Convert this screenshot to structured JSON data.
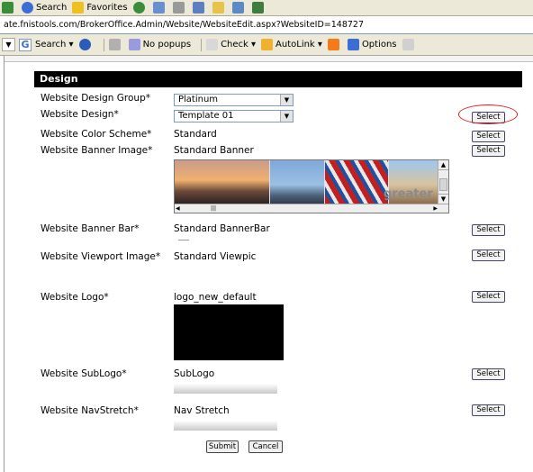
{
  "toolbar1": {
    "search_label": "Search",
    "favorites_label": "Favorites"
  },
  "address": {
    "url": "ate.fnistools.com/BrokerOffice.Admin/Website/WebsiteEdit.aspx?WebsiteID=148727"
  },
  "toolbar3": {
    "google_letter": "G",
    "search_label": "Search",
    "popups_label": "No popups",
    "check_label": "Check",
    "autolink_label": "AutoLink",
    "options_label": "Options"
  },
  "section": {
    "title": "Design"
  },
  "fields": {
    "design_group": {
      "label": "Website Design Group*",
      "value": "Platinum"
    },
    "design": {
      "label": "Website Design*",
      "value": "Template 01"
    },
    "color_scheme": {
      "label": "Website Color Scheme*",
      "value": "Standard"
    },
    "banner_image": {
      "label": "Website Banner Image*",
      "value": "Standard Banner",
      "overlay_text": "greater s"
    },
    "banner_bar": {
      "label": "Website Banner Bar*",
      "value": "Standard BannerBar"
    },
    "viewport_image": {
      "label": "Website Viewport Image*",
      "value": "Standard Viewpic"
    },
    "logo": {
      "label": "Website Logo*",
      "value": "logo_new_default"
    },
    "sublogo": {
      "label": "Website SubLogo*",
      "value": "SubLogo"
    },
    "navstretch": {
      "label": "Website NavStretch*",
      "value": "Nav Stretch"
    }
  },
  "buttons": {
    "select": "Select",
    "submit": "Submit",
    "cancel": "Cancel"
  },
  "highlight_color": "#e01a1a"
}
